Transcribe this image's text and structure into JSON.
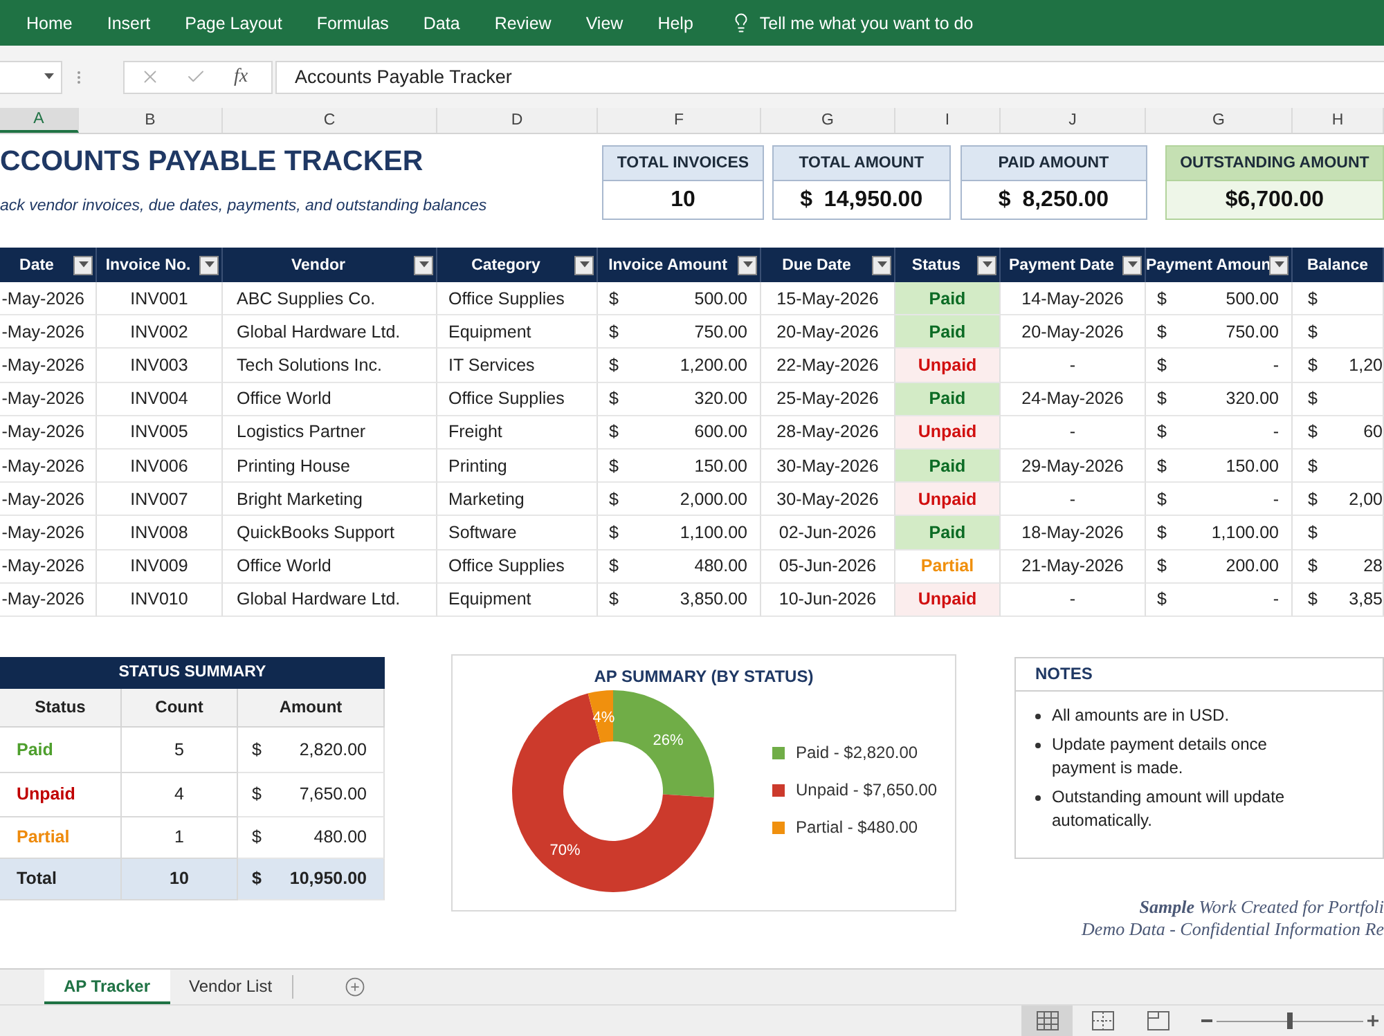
{
  "ribbon": {
    "tabs": [
      "Home",
      "Insert",
      "Page Layout",
      "Formulas",
      "Data",
      "Review",
      "View",
      "Help"
    ],
    "tell_me": "Tell me what you want to do"
  },
  "formula_bar": {
    "function_label": "fx",
    "formula": "Accounts Payable Tracker"
  },
  "column_headers": [
    {
      "label": "A",
      "selected": true
    },
    {
      "label": "B",
      "selected": false
    },
    {
      "label": "C",
      "selected": false
    },
    {
      "label": "D",
      "selected": false
    },
    {
      "label": "F",
      "selected": false
    },
    {
      "label": "G",
      "selected": false
    },
    {
      "label": "I",
      "selected": false
    },
    {
      "label": "J",
      "selected": false
    },
    {
      "label": "G",
      "selected": false
    },
    {
      "label": "H",
      "selected": false
    }
  ],
  "sheet": {
    "title": "CCOUNTS PAYABLE TRACKER",
    "subtitle": "ack vendor invoices, due dates, payments, and outstanding balances",
    "kpis": [
      {
        "label": "TOTAL INVOICES",
        "value": "10",
        "kind": "standard"
      },
      {
        "label": "TOTAL AMOUNT",
        "value": "$ 14,950.00",
        "kind": "standard"
      },
      {
        "label": "PAID AMOUNT",
        "value": "$ 8,250.00",
        "kind": "standard"
      },
      {
        "label": "OUTSTANDING AMOUNT",
        "value": "$6,700.00",
        "kind": "outstanding"
      }
    ],
    "table": {
      "columns": [
        {
          "label": "Date",
          "filter": true
        },
        {
          "label": "Invoice No.",
          "filter": true
        },
        {
          "label": "Vendor",
          "filter": true
        },
        {
          "label": "Category",
          "filter": true
        },
        {
          "label": "Invoice Amount",
          "filter": true
        },
        {
          "label": "Due Date",
          "filter": true
        },
        {
          "label": "Status",
          "filter": true
        },
        {
          "label": "Payment Date",
          "filter": true
        },
        {
          "label": "Payment Amoun",
          "filter": true
        },
        {
          "label": "Balance",
          "filter": false
        }
      ],
      "rows": [
        {
          "date": "-May-2026",
          "invoice_no": "INV001",
          "vendor": "ABC Supplies Co.",
          "category": "Office Supplies",
          "invoice_amount": {
            "symbol": "$",
            "amount": "500.00"
          },
          "due_date": "15-May-2026",
          "status": {
            "text": "Paid",
            "kind": "paid"
          },
          "payment_date": "14-May-2026",
          "payment_amount": {
            "symbol": "$",
            "amount": "500.00"
          },
          "balance": {
            "symbol": "$"
          }
        },
        {
          "date": "-May-2026",
          "invoice_no": "INV002",
          "vendor": "Global Hardware Ltd.",
          "category": "Equipment",
          "invoice_amount": {
            "symbol": "$",
            "amount": "750.00"
          },
          "due_date": "20-May-2026",
          "status": {
            "text": "Paid",
            "kind": "paid"
          },
          "payment_date": "20-May-2026",
          "payment_amount": {
            "symbol": "$",
            "amount": "750.00"
          },
          "balance": {
            "symbol": "$"
          }
        },
        {
          "date": "-May-2026",
          "invoice_no": "INV003",
          "vendor": "Tech Solutions Inc.",
          "category": "IT Services",
          "invoice_amount": {
            "symbol": "$",
            "amount": "1,200.00"
          },
          "due_date": "22-May-2026",
          "status": {
            "text": "Unpaid",
            "kind": "unpaid"
          },
          "payment_date": "-",
          "payment_amount": {
            "symbol": "$",
            "amount": "-"
          },
          "balance": {
            "symbol": "$",
            "amount": "1,20"
          }
        },
        {
          "date": "-May-2026",
          "invoice_no": "INV004",
          "vendor": "Office World",
          "category": "Office Supplies",
          "invoice_amount": {
            "symbol": "$",
            "amount": "320.00"
          },
          "due_date": "25-May-2026",
          "status": {
            "text": "Paid",
            "kind": "paid"
          },
          "payment_date": "24-May-2026",
          "payment_amount": {
            "symbol": "$",
            "amount": "320.00"
          },
          "balance": {
            "symbol": "$"
          }
        },
        {
          "date": "-May-2026",
          "invoice_no": "INV005",
          "vendor": "Logistics Partner",
          "category": "Freight",
          "invoice_amount": {
            "symbol": "$",
            "amount": "600.00"
          },
          "due_date": "28-May-2026",
          "status": {
            "text": "Unpaid",
            "kind": "unpaid"
          },
          "payment_date": "-",
          "payment_amount": {
            "symbol": "$",
            "amount": "-"
          },
          "balance": {
            "symbol": "$",
            "amount": "60"
          }
        },
        {
          "date": "-May-2026",
          "invoice_no": "INV006",
          "vendor": "Printing House",
          "category": "Printing",
          "invoice_amount": {
            "symbol": "$",
            "amount": "150.00"
          },
          "due_date": "30-May-2026",
          "status": {
            "text": "Paid",
            "kind": "paid"
          },
          "payment_date": "29-May-2026",
          "payment_amount": {
            "symbol": "$",
            "amount": "150.00"
          },
          "balance": {
            "symbol": "$"
          }
        },
        {
          "date": "-May-2026",
          "invoice_no": "INV007",
          "vendor": "Bright Marketing",
          "category": "Marketing",
          "invoice_amount": {
            "symbol": "$",
            "amount": "2,000.00"
          },
          "due_date": "30-May-2026",
          "status": {
            "text": "Unpaid",
            "kind": "unpaid"
          },
          "payment_date": "-",
          "payment_amount": {
            "symbol": "$",
            "amount": "-"
          },
          "balance": {
            "symbol": "$",
            "amount": "2,00"
          }
        },
        {
          "date": "-May-2026",
          "invoice_no": "INV008",
          "vendor": "QuickBooks Support",
          "category": "Software",
          "invoice_amount": {
            "symbol": "$",
            "amount": "1,100.00"
          },
          "due_date": "02-Jun-2026",
          "status": {
            "text": "Paid",
            "kind": "paid"
          },
          "payment_date": "18-May-2026",
          "payment_amount": {
            "symbol": "$",
            "amount": "1,100.00"
          },
          "balance": {
            "symbol": "$"
          }
        },
        {
          "date": "-May-2026",
          "invoice_no": "INV009",
          "vendor": "Office World",
          "category": "Office Supplies",
          "invoice_amount": {
            "symbol": "$",
            "amount": "480.00"
          },
          "due_date": "05-Jun-2026",
          "status": {
            "text": "Partial",
            "kind": "partial"
          },
          "payment_date": "21-May-2026",
          "payment_amount": {
            "symbol": "$",
            "amount": "200.00"
          },
          "balance": {
            "symbol": "$",
            "amount": "28"
          }
        },
        {
          "date": "-May-2026",
          "invoice_no": "INV010",
          "vendor": "Global Hardware Ltd.",
          "category": "Equipment",
          "invoice_amount": {
            "symbol": "$",
            "amount": "3,850.00"
          },
          "due_date": "10-Jun-2026",
          "status": {
            "text": "Unpaid",
            "kind": "unpaid"
          },
          "payment_date": "-",
          "payment_amount": {
            "symbol": "$",
            "amount": "-"
          },
          "balance": {
            "symbol": "$",
            "amount": "3,85"
          }
        }
      ]
    },
    "status_summary": {
      "title": "STATUS SUMMARY",
      "columns": [
        "Status",
        "Count",
        "Amount"
      ],
      "rows": [
        {
          "status": "Paid",
          "kind": "paid",
          "count": "5",
          "symbol": "$",
          "amount": "2,820.00"
        },
        {
          "status": "Unpaid",
          "kind": "unpaid",
          "count": "4",
          "symbol": "$",
          "amount": "7,650.00"
        },
        {
          "status": "Partial",
          "kind": "partial",
          "count": "1",
          "symbol": "$",
          "amount": "480.00"
        }
      ],
      "total": {
        "label": "Total",
        "count": "10",
        "symbol": "$",
        "amount": "10,950.00"
      }
    },
    "chart": {
      "chart_data": {
        "type": "donut",
        "title": "AP SUMMARY (BY STATUS)",
        "categories": [
          "Paid - $2,820.00",
          "Unpaid - $7,650.00",
          "Partial - $480.00"
        ],
        "values": [
          26,
          70,
          4
        ],
        "value_labels": [
          "26%",
          "70%",
          "4%"
        ],
        "legend": "right"
      },
      "slices": [
        {
          "color": "#70ad47"
        },
        {
          "color": "#cc3a2c"
        },
        {
          "color": "#f0900e"
        }
      ]
    },
    "notes": {
      "title": "NOTES",
      "items": [
        "All amounts are in USD.",
        "Update payment details once payment is made.",
        "Outstanding amount will update automatically."
      ]
    },
    "footer": [
      "**Sample** Work Created for Portfoli",
      "Demo Data - Confidential Information Re"
    ]
  },
  "sheet_tabs": [
    {
      "label": "AP Tracker",
      "selected": true
    },
    {
      "label": "Vendor List",
      "selected": false
    }
  ],
  "status_bar": {
    "views": [
      {
        "kind": "normal",
        "selected": true
      },
      {
        "kind": "page-break",
        "selected": false
      },
      {
        "kind": "page-layout",
        "selected": false
      }
    ],
    "zoom": {
      "level": 0.5
    }
  }
}
